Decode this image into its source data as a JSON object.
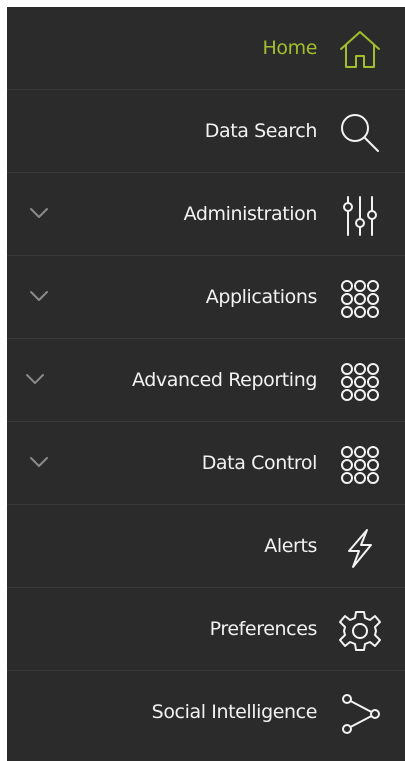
{
  "menu": {
    "items": [
      {
        "label": "Home",
        "icon": "home-icon",
        "active": true,
        "expandable": false
      },
      {
        "label": "Data Search",
        "icon": "search-icon",
        "active": false,
        "expandable": false
      },
      {
        "label": "Administration",
        "icon": "sliders-icon",
        "active": false,
        "expandable": true
      },
      {
        "label": "Applications",
        "icon": "grid-dots-icon",
        "active": false,
        "expandable": true
      },
      {
        "label": "Advanced Reporting",
        "icon": "grid-dots-icon",
        "active": false,
        "expandable": true
      },
      {
        "label": "Data Control",
        "icon": "grid-dots-icon",
        "active": false,
        "expandable": true
      },
      {
        "label": "Alerts",
        "icon": "lightning-icon",
        "active": false,
        "expandable": false
      },
      {
        "label": "Preferences",
        "icon": "gear-icon",
        "active": false,
        "expandable": false
      },
      {
        "label": "Social Intelligence",
        "icon": "share-nodes-icon",
        "active": false,
        "expandable": false
      }
    ]
  },
  "colors": {
    "background": "#2b2b2b",
    "text": "#f2f2f2",
    "accent": "#a1bf2c",
    "chevron": "#8a8a8a"
  }
}
